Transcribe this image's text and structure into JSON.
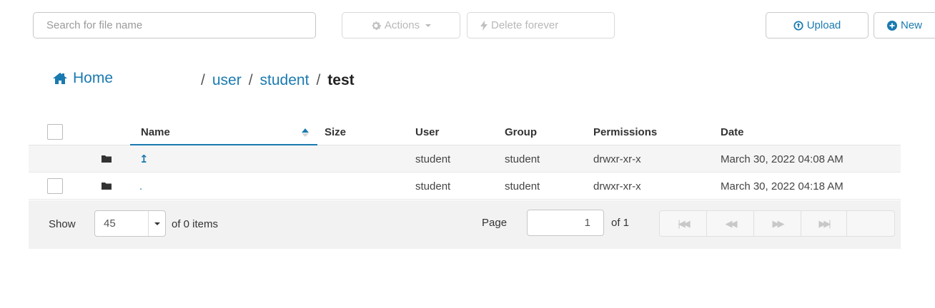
{
  "toolbar": {
    "search_placeholder": "Search for file name",
    "actions_label": "Actions",
    "delete_label": "Delete forever",
    "upload_label": "Upload",
    "new_label": "New"
  },
  "breadcrumb": {
    "home": "Home",
    "separator": "/",
    "parts": [
      "user",
      "student"
    ],
    "current": "test"
  },
  "table": {
    "columns": {
      "name": "Name",
      "size": "Size",
      "user": "User",
      "group": "Group",
      "permissions": "Permissions",
      "date": "Date"
    },
    "rows": [
      {
        "name": "↥",
        "size": "",
        "user": "student",
        "group": "student",
        "permissions": "drwxr-xr-x",
        "date": "March 30, 2022 04:08 AM"
      },
      {
        "name": ".",
        "size": "",
        "user": "student",
        "group": "student",
        "permissions": "drwxr-xr-x",
        "date": "March 30, 2022 04:18 AM"
      }
    ]
  },
  "pagination": {
    "show_label": "Show",
    "page_size": "45",
    "items_label": "of 0 items",
    "page_label": "Page",
    "page_value": "1",
    "of_label": "of 1"
  },
  "icons": {
    "gear": "gear-icon",
    "bolt": "bolt-icon",
    "upload": "upload-circle-icon",
    "new": "plus-circle-icon",
    "home": "home-icon",
    "folder": "folder-icon",
    "sort": "sort-ascending-icon"
  },
  "colors": {
    "accent": "#1a7ab0",
    "row_alt": "#f5f5f5",
    "footer_bg": "#f2f2f2"
  }
}
